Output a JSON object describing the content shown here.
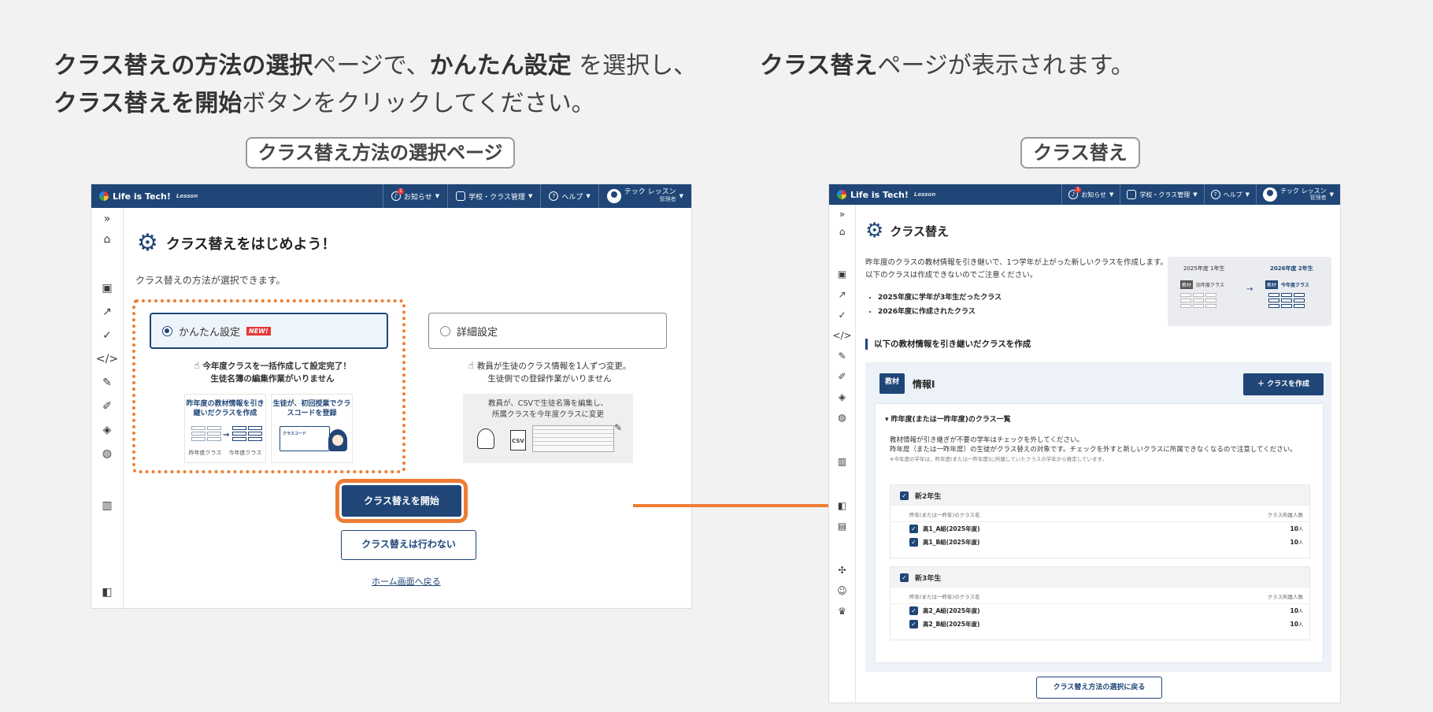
{
  "captions": {
    "left": {
      "b1": "クラス替えの方法の選択",
      "t1": "ページで、",
      "b2": "かんたん設定",
      "t2": " を選択し、",
      "b3": "クラス替えを開始",
      "t3": "ボタンをクリックしてください。"
    },
    "right": {
      "b1": "クラス替え",
      "t1": "ページが表示されます。"
    }
  },
  "tags": {
    "left": "クラス替え方法の選択ページ",
    "right": "クラス替え"
  },
  "topbar": {
    "logo": "Life is Tech!",
    "logo_sub": "Lesson",
    "notice": "お知らせ",
    "notice_badge": "1",
    "school": "学校・クラス管理",
    "help": "ヘルプ",
    "user_name": "テック レッスン",
    "user_role": "管理者"
  },
  "left_screen": {
    "title": "クラス替えをはじめよう！",
    "description": "クラス替えの方法が選択できます。",
    "option_easy": {
      "label": "かんたん設定",
      "badge": "NEW!",
      "hint_line1": "今年度クラスを一括作成して設定完了！",
      "hint_line2": "生徒名簿の編集作業がいりません",
      "card1_title": "昨年度の教材情報を引き継いだクラスを作成",
      "card1_from": "昨年度クラス",
      "card1_to": "今年度クラス",
      "card2_title": "生徒が、初回授業でクラスコードを登録",
      "card2_code_label": "クラスコード"
    },
    "option_detail": {
      "label": "詳細設定",
      "hint_line1": "教員が生徒のクラス情報を1人ずつ変更。",
      "hint_line2": "生徒側での登録作業がいりません",
      "box_line1": "教員が、CSVで生徒名簿を編集し、",
      "box_line2": "所属クラスを今年度クラスに変更",
      "csv_label": "CSV"
    },
    "start_button": "クラス替えを開始",
    "skip_button": "クラス替えは行わない",
    "home_link": "ホーム画面へ戻る"
  },
  "right_screen": {
    "title": "クラス替え",
    "description": "昨年度のクラスの教材情報を引き継いで、1つ学年が上がった新しいクラスを作成します。以下のクラスは作成できないのでご注意ください。",
    "bullets": [
      "2025年度に学年が3年生だったクラス",
      "2026年度に作成されたクラス"
    ],
    "diagram": {
      "from_year": "2025年度 1年生",
      "to_year": "2026年度 2年生",
      "material_tag": "教材",
      "from_label": "旧年度クラス",
      "to_label": "今年度クラス"
    },
    "section_heading": "以下の教材情報を引き継いだクラスを作成",
    "material_badge": "教材",
    "material_name": "情報Ⅰ",
    "create_button": "＋ クラスを作成",
    "accordion_title": "昨年度(または一昨年度)のクラス一覧",
    "note_line1": "教材情報が引き継ぎが不要の学年はチェックを外してください。",
    "note_line2": "昨年度（または一昨年度）の生徒がクラス替えの対象です。チェックを外すと新しいクラスに所属できなくなるので注意してください。",
    "note_small": "※今年度の学年は、昨年度(または一昨年度)に所属していたクラスの学年から推定しています。",
    "col_name": "昨年(または一昨年)のクラス名",
    "col_count": "クラス所属人数",
    "groups": [
      {
        "title": "新2年生",
        "rows": [
          {
            "name": "高1_A組(2025年度)",
            "count": "10",
            "unit": "人"
          },
          {
            "name": "高1_B組(2025年度)",
            "count": "10",
            "unit": "人"
          }
        ]
      },
      {
        "title": "新3年生",
        "rows": [
          {
            "name": "高2_A組(2025年度)",
            "count": "10",
            "unit": "人"
          },
          {
            "name": "高2_B組(2025年度)",
            "count": "10",
            "unit": "人"
          }
        ]
      }
    ],
    "back_button": "クラス替え方法の選択に戻る"
  },
  "colors": {
    "navy": "#1f4677",
    "accent_orange": "#ee7d33",
    "new_badge": "#e53935"
  },
  "icons": {
    "sidebar_left": [
      "expand-icon",
      "home-icon",
      "terminal-icon",
      "trend-icon",
      "check-circle-icon",
      "code-icon",
      "pen-icon",
      "edit-icon",
      "python-icon",
      "palette-icon",
      "chart-icon",
      "book-icon"
    ],
    "sidebar_right": [
      "expand-icon",
      "home-icon",
      "terminal-icon",
      "trend-icon",
      "check-circle-icon",
      "code-icon",
      "pen-icon",
      "edit-icon",
      "python-icon",
      "palette-icon",
      "chart-icon",
      "book-icon",
      "file-icon",
      "puzzle-icon",
      "smile-icon",
      "trophy-icon"
    ]
  }
}
